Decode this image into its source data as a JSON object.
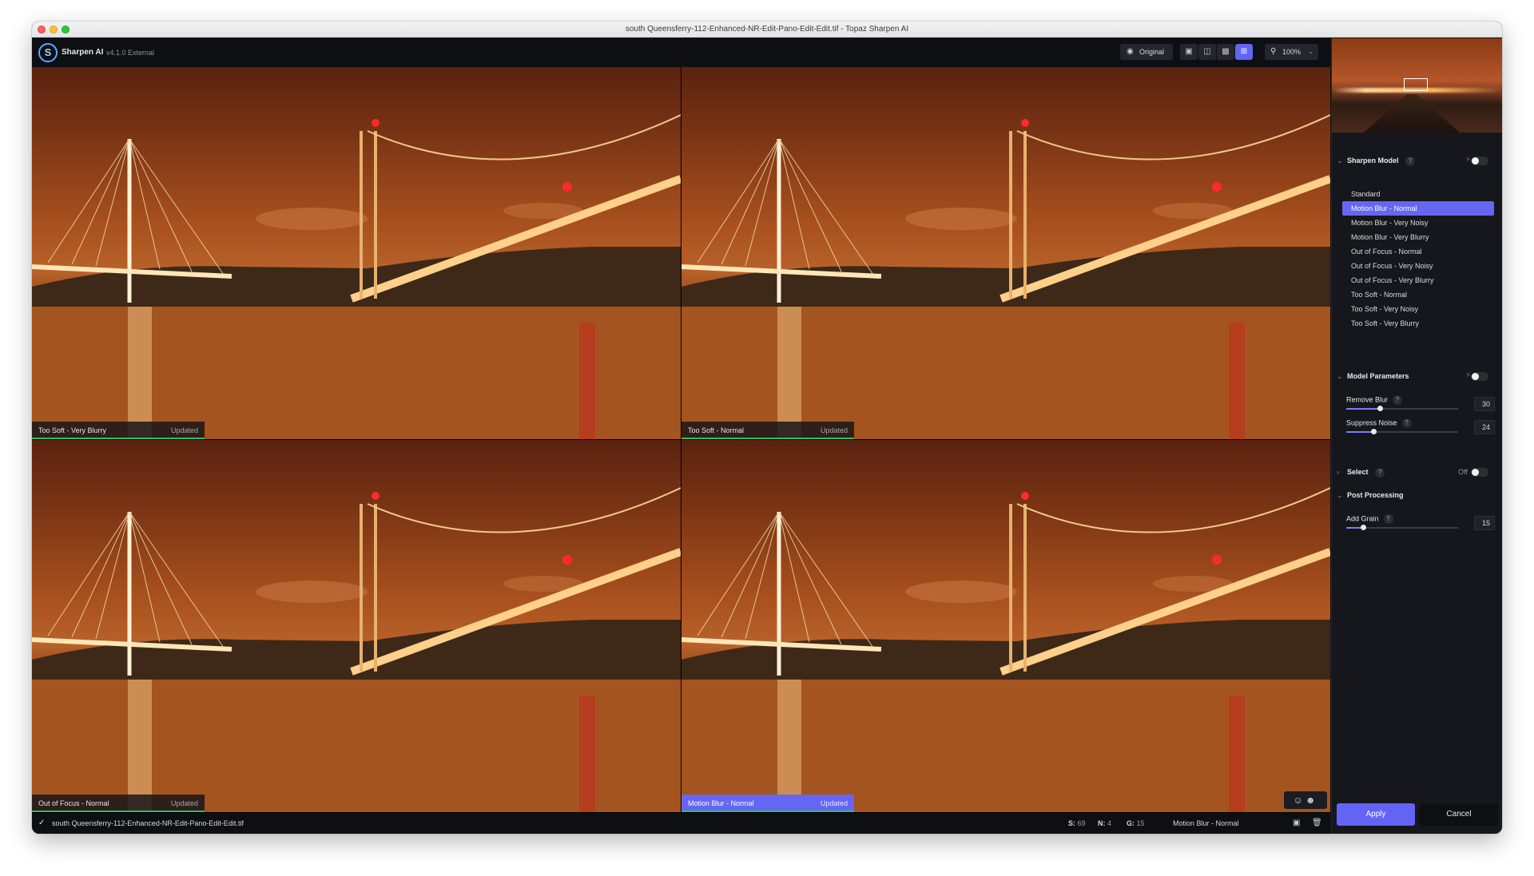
{
  "window": {
    "title": "south Queensferry-112-Enhanced-NR-Edit-Pano-Edit-Edit.tif - Topaz Sharpen AI"
  },
  "topbar": {
    "app_name": "Sharpen AI",
    "version": "v4.1.0 External",
    "original_label": "Original",
    "zoom_label": "100%",
    "view_modes": [
      "single-view-icon",
      "split-view-icon",
      "side-by-side-icon",
      "quad-view-icon"
    ],
    "active_view": "quad-view-icon"
  },
  "previews": [
    {
      "label": "Too Soft - Very Blurry",
      "status": "Updated"
    },
    {
      "label": "Too Soft - Normal",
      "status": "Updated"
    },
    {
      "label": "Out of Focus - Normal",
      "status": "Updated"
    },
    {
      "label": "Motion Blur - Normal",
      "status": "Updated"
    }
  ],
  "statusbar": {
    "filename": "south Queensferry-112-Enhanced-NR-Edit-Pano-Edit-Edit.tif",
    "s_label": "S:",
    "s_value": "69",
    "n_label": "N:",
    "n_value": "4",
    "g_label": "G:",
    "g_value": "15",
    "model": "Motion Blur - Normal"
  },
  "sidebar": {
    "sharpen_model": {
      "title": "Sharpen Model",
      "items": [
        "Standard",
        "Motion Blur - Normal",
        "Motion Blur - Very Noisy",
        "Motion Blur - Very Blurry",
        "Out of Focus - Normal",
        "Out of Focus - Very Noisy",
        "Out of Focus - Very Blurry",
        "Too Soft - Normal",
        "Too Soft - Very Noisy",
        "Too Soft - Very Blurry"
      ],
      "selected": "Motion Blur - Normal"
    },
    "model_parameters": {
      "title": "Model Parameters",
      "remove_blur": {
        "label": "Remove Blur",
        "value": "30",
        "fraction": 0.3
      },
      "suppress_noise": {
        "label": "Suppress Noise",
        "value": "24",
        "fraction": 0.24
      }
    },
    "select": {
      "title": "Select",
      "state": "Off"
    },
    "post_processing": {
      "title": "Post Processing",
      "add_grain": {
        "label": "Add Grain",
        "value": "15",
        "fraction": 0.15
      }
    },
    "apply_label": "Apply",
    "cancel_label": "Cancel"
  },
  "colors": {
    "accent": "#6264f5",
    "updated_bar": "#2fbf6a",
    "panel_bg": "#15171c"
  }
}
